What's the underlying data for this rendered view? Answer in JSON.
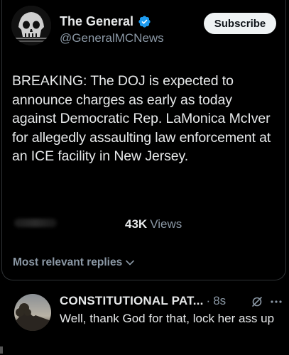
{
  "post": {
    "display_name": "The General",
    "handle": "@GeneralMCNews",
    "subscribe_label": "Subscribe",
    "text": "BREAKING: The DOJ is expected to announce charges as early as today against Democratic Rep. LaMonica McIver for allegedly assaulting law enforcement at an ICE facility in New Jersey.",
    "views_count": "43K",
    "views_label": "Views"
  },
  "replies": {
    "filter_label": "Most relevant replies"
  },
  "reply": {
    "name": "CONSTITUTIONAL PAT...",
    "separator": "·",
    "time": "8s",
    "text": "Well, thank God for that,  lock her ass up"
  },
  "colors": {
    "background": "#000000",
    "text_primary": "#e7e9ea",
    "text_secondary": "#8b98a5",
    "verified_blue": "#1d9bf0",
    "button_bg": "#eff3f4"
  },
  "icons": {
    "verified": "verified-badge-icon",
    "chevron": "chevron-down-icon",
    "grok": "grok-icon",
    "more": "more-icon"
  }
}
